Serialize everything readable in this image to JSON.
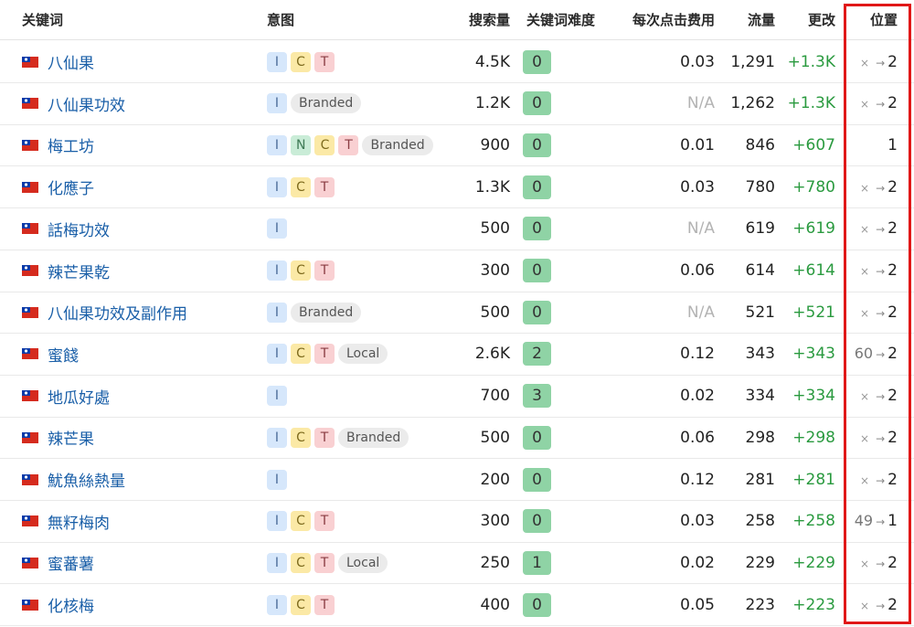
{
  "headers": {
    "keyword": "关键词",
    "intent": "意图",
    "volume": "搜索量",
    "kd": "关键词难度",
    "cpc": "每次点击费用",
    "traffic": "流量",
    "change": "更改",
    "position": "位置"
  },
  "colors": {
    "highlight_box": "#e01818",
    "kd_badge": "#8fd3a5",
    "change_positive": "#2a9a3f",
    "keyword_link": "#1a5fa8"
  },
  "rows": [
    {
      "keyword": "八仙果",
      "country_flag": "taiwan-flag-icon",
      "intents": [
        "I",
        "C",
        "T"
      ],
      "volume": "4.5K",
      "kd": "0",
      "cpc": "0.03",
      "traffic": "1,291",
      "change": "+1.3K",
      "pos_from": "×",
      "pos_to": "2"
    },
    {
      "keyword": "八仙果功效",
      "country_flag": "taiwan-flag-icon",
      "intents": [
        "I",
        "Branded"
      ],
      "volume": "1.2K",
      "kd": "0",
      "cpc": "N/A",
      "traffic": "1,262",
      "change": "+1.3K",
      "pos_from": "×",
      "pos_to": "2"
    },
    {
      "keyword": "梅工坊",
      "country_flag": "taiwan-flag-icon",
      "intents": [
        "I",
        "N",
        "C",
        "T",
        "Branded"
      ],
      "volume": "900",
      "kd": "0",
      "cpc": "0.01",
      "traffic": "846",
      "change": "+607",
      "pos_from": "",
      "pos_to": "1"
    },
    {
      "keyword": "化應子",
      "country_flag": "taiwan-flag-icon",
      "intents": [
        "I",
        "C",
        "T"
      ],
      "volume": "1.3K",
      "kd": "0",
      "cpc": "0.03",
      "traffic": "780",
      "change": "+780",
      "pos_from": "×",
      "pos_to": "2"
    },
    {
      "keyword": "話梅功效",
      "country_flag": "taiwan-flag-icon",
      "intents": [
        "I"
      ],
      "volume": "500",
      "kd": "0",
      "cpc": "N/A",
      "traffic": "619",
      "change": "+619",
      "pos_from": "×",
      "pos_to": "2"
    },
    {
      "keyword": "辣芒果乾",
      "country_flag": "taiwan-flag-icon",
      "intents": [
        "I",
        "C",
        "T"
      ],
      "volume": "300",
      "kd": "0",
      "cpc": "0.06",
      "traffic": "614",
      "change": "+614",
      "pos_from": "×",
      "pos_to": "2"
    },
    {
      "keyword": "八仙果功效及副作用",
      "country_flag": "taiwan-flag-icon",
      "intents": [
        "I",
        "Branded"
      ],
      "volume": "500",
      "kd": "0",
      "cpc": "N/A",
      "traffic": "521",
      "change": "+521",
      "pos_from": "×",
      "pos_to": "2"
    },
    {
      "keyword": "蜜餞",
      "country_flag": "taiwan-flag-icon",
      "intents": [
        "I",
        "C",
        "T",
        "Local"
      ],
      "volume": "2.6K",
      "kd": "2",
      "cpc": "0.12",
      "traffic": "343",
      "change": "+343",
      "pos_from": "60",
      "pos_to": "2"
    },
    {
      "keyword": "地瓜好處",
      "country_flag": "taiwan-flag-icon",
      "intents": [
        "I"
      ],
      "volume": "700",
      "kd": "3",
      "cpc": "0.02",
      "traffic": "334",
      "change": "+334",
      "pos_from": "×",
      "pos_to": "2"
    },
    {
      "keyword": "辣芒果",
      "country_flag": "taiwan-flag-icon",
      "intents": [
        "I",
        "C",
        "T",
        "Branded"
      ],
      "volume": "500",
      "kd": "0",
      "cpc": "0.06",
      "traffic": "298",
      "change": "+298",
      "pos_from": "×",
      "pos_to": "2"
    },
    {
      "keyword": "魷魚絲熱量",
      "country_flag": "taiwan-flag-icon",
      "intents": [
        "I"
      ],
      "volume": "200",
      "kd": "0",
      "cpc": "0.12",
      "traffic": "281",
      "change": "+281",
      "pos_from": "×",
      "pos_to": "2"
    },
    {
      "keyword": "無籽梅肉",
      "country_flag": "taiwan-flag-icon",
      "intents": [
        "I",
        "C",
        "T"
      ],
      "volume": "300",
      "kd": "0",
      "cpc": "0.03",
      "traffic": "258",
      "change": "+258",
      "pos_from": "49",
      "pos_to": "1"
    },
    {
      "keyword": "蜜蕃薯",
      "country_flag": "taiwan-flag-icon",
      "intents": [
        "I",
        "C",
        "T",
        "Local"
      ],
      "volume": "250",
      "kd": "1",
      "cpc": "0.02",
      "traffic": "229",
      "change": "+229",
      "pos_from": "×",
      "pos_to": "2"
    },
    {
      "keyword": "化核梅",
      "country_flag": "taiwan-flag-icon",
      "intents": [
        "I",
        "C",
        "T"
      ],
      "volume": "400",
      "kd": "0",
      "cpc": "0.05",
      "traffic": "223",
      "change": "+223",
      "pos_from": "×",
      "pos_to": "2"
    }
  ]
}
